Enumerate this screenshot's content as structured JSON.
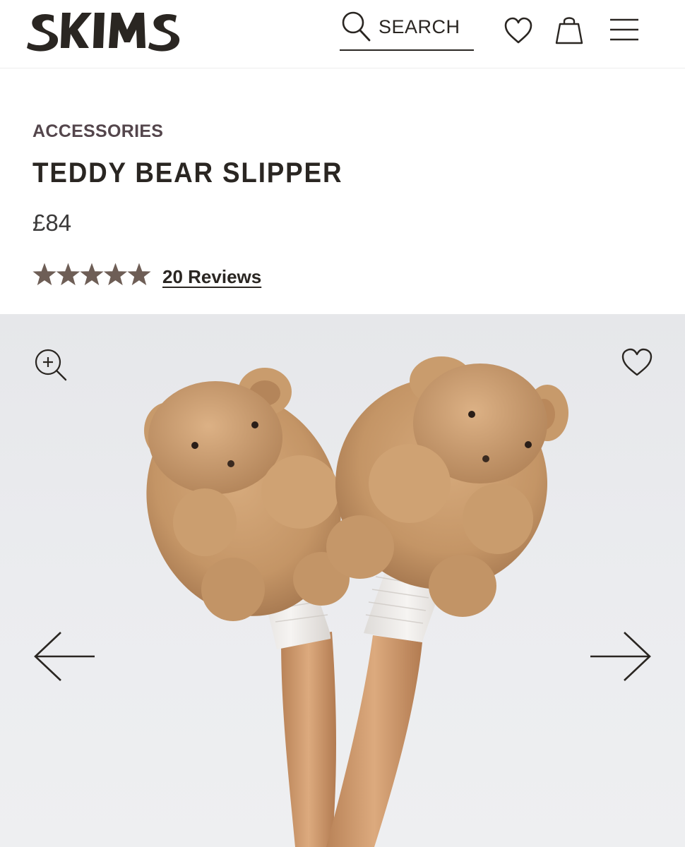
{
  "header": {
    "logo_text": "SKIMS",
    "search_label": "SEARCH",
    "icons": [
      "search-icon",
      "heart-icon",
      "shopping-bag-icon",
      "menu-icon"
    ]
  },
  "product": {
    "category": "ACCESSORIES",
    "title": "TEDDY BEAR SLIPPER",
    "price": "£84",
    "rating": 5,
    "rating_max": 5,
    "reviews_label": "20 Reviews"
  },
  "gallery": {
    "icons": [
      "zoom-in-icon",
      "heart-icon",
      "arrow-left-icon",
      "arrow-right-icon"
    ]
  },
  "colors": {
    "text": "#2a2622",
    "category": "#54464c",
    "star": "#6e5e56",
    "background_photo": "#e8e9ec",
    "slipper": "#c89a6c"
  }
}
